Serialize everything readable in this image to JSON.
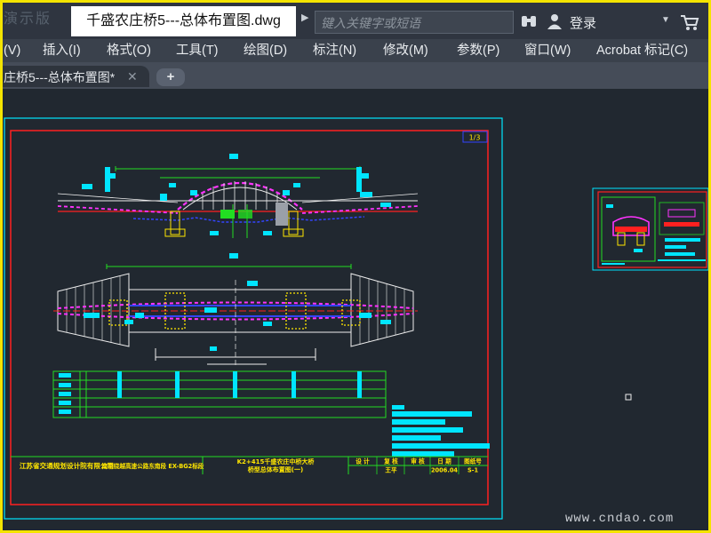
{
  "app": {
    "logo_text": "演示版",
    "document_title": "千盛农庄桥5---总体布置图.dwg",
    "search_placeholder": "键入关键字或短语",
    "login_label": "登录"
  },
  "menu": [
    {
      "label": "(V)"
    },
    {
      "label": "插入(I)"
    },
    {
      "label": "格式(O)"
    },
    {
      "label": "工具(T)"
    },
    {
      "label": "绘图(D)"
    },
    {
      "label": "标注(N)"
    },
    {
      "label": "修改(M)"
    },
    {
      "label": "参数(P)"
    },
    {
      "label": "窗口(W)"
    },
    {
      "label": "Acrobat 标记(C)"
    }
  ],
  "tabs": [
    {
      "label": "庄桥5---总体布置图*",
      "close": "✕"
    }
  ],
  "new_tab_label": "+",
  "drawing": {
    "sheet_number": "1/3",
    "design_company": "江苏省交通规划设计院有限公司",
    "project_name": "南京绕越高速公路东南段 EX-BG2标段",
    "drawing_title_line1": "K2+415千盛农庄中桥大桥",
    "drawing_title_line2": "桥型总体布置图(一)",
    "approval_headers": [
      "设 计",
      "复 核",
      "审 核",
      "日 期",
      "图纸号"
    ],
    "approval_values": [
      "",
      "王平",
      "",
      "2006.04",
      "S-1"
    ]
  },
  "watermark": "www.cndao.com",
  "colors": {
    "canvas_bg": "#212830",
    "frame_highlight": "#f4e400",
    "cad_red": "#ff2020",
    "cad_cyan": "#00e5ff",
    "cad_green": "#22dd22",
    "cad_magenta": "#ff33ff",
    "cad_yellow": "#ffe600",
    "cad_white": "#eeeeee",
    "cad_blue": "#3344ff"
  },
  "icons": [
    "binoculars-icon",
    "user-icon",
    "cart-icon",
    "close-icon",
    "add-icon",
    "dropdown-icon",
    "search-arrow-icon"
  ]
}
